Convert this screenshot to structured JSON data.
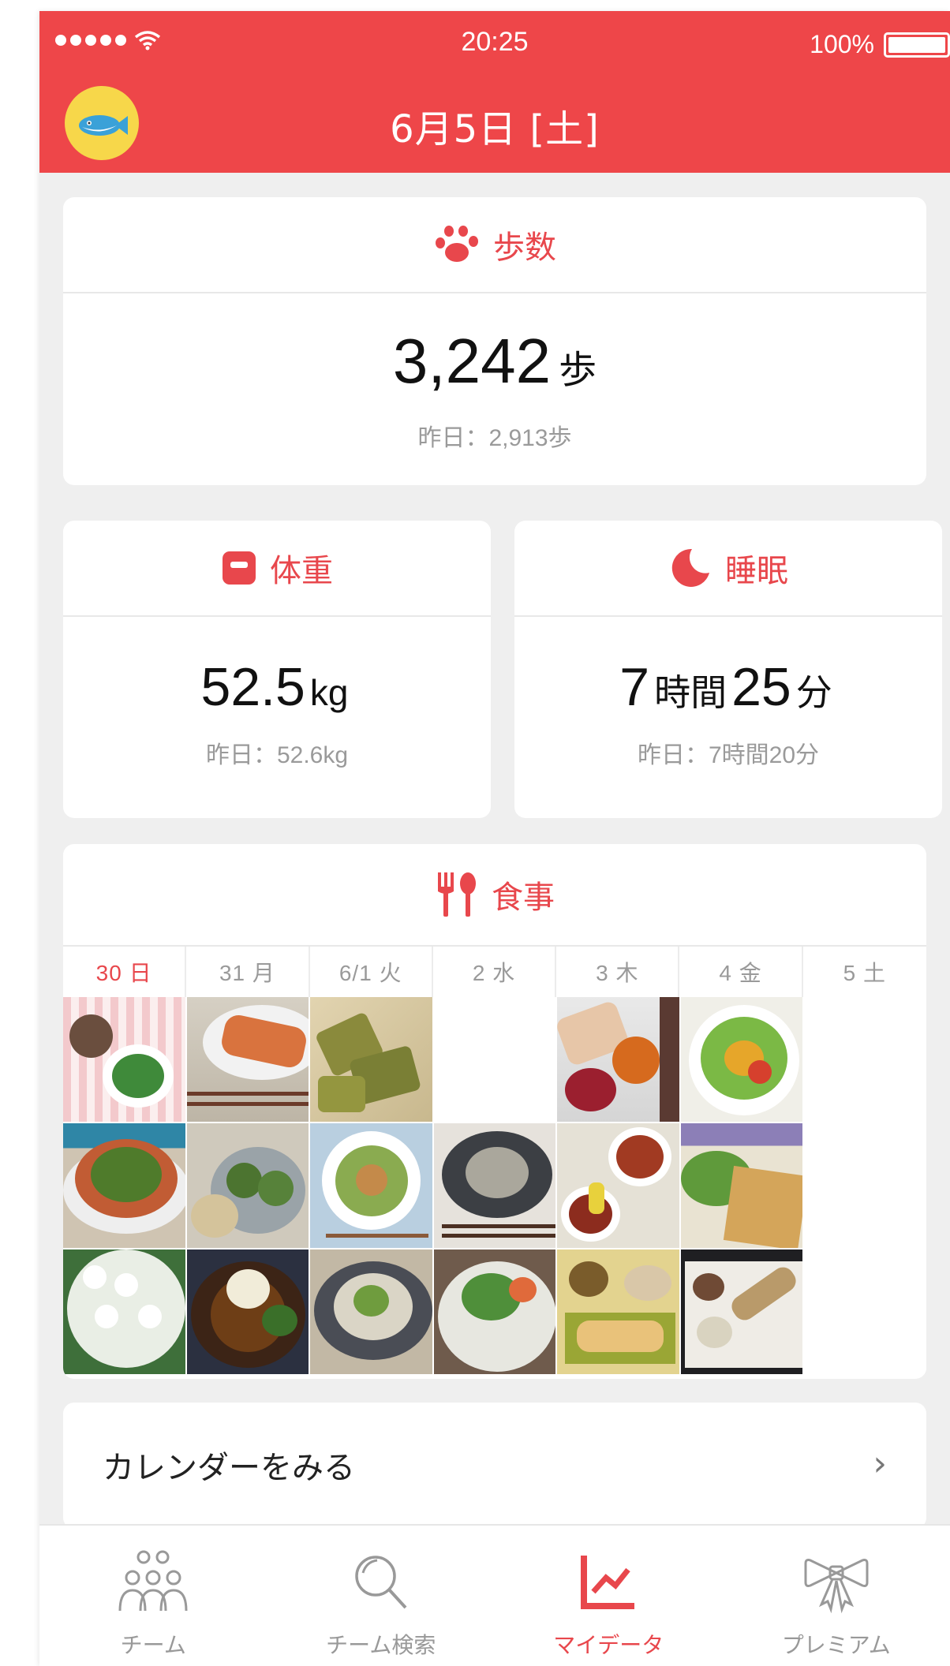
{
  "status_bar": {
    "time": "20:25",
    "battery": "100%"
  },
  "header": {
    "title": "6月5日 [土]"
  },
  "steps": {
    "title": "歩数",
    "value": "3,242",
    "unit": "歩",
    "yesterday": "昨日：2,913歩"
  },
  "weight": {
    "title": "体重",
    "value": "52.5",
    "unit": "kg",
    "yesterday": "昨日：52.6kg"
  },
  "sleep": {
    "title": "睡眠",
    "hours": "7",
    "hours_unit": "時間",
    "minutes": "25",
    "minutes_unit": "分",
    "yesterday": "昨日：7時間20分"
  },
  "meal": {
    "title": "食事",
    "days": [
      "30 日",
      "31 月",
      "6/1 火",
      "2 水",
      "3 木",
      "4 金",
      "5 土"
    ]
  },
  "calendar_link": {
    "label": "カレンダーをみる",
    "chevron": "›"
  },
  "tabbar": {
    "items": [
      {
        "label": "チーム",
        "icon": "team-icon"
      },
      {
        "label": "チーム検索",
        "icon": "search-icon"
      },
      {
        "label": "マイデータ",
        "icon": "chart-icon"
      },
      {
        "label": "プレミアム",
        "icon": "ribbon-icon"
      }
    ]
  },
  "colors": {
    "accent": "#ee4649",
    "background": "#efefef"
  }
}
